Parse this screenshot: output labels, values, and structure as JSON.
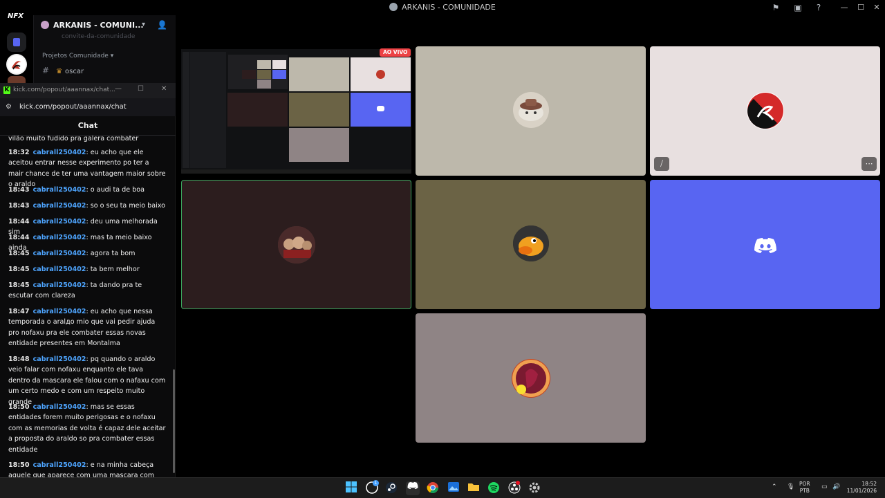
{
  "window": {
    "title": "ARKANIS - COMUNIDADE"
  },
  "rail": {
    "logo": "NFX"
  },
  "channels": {
    "guild_name": "ARKANIS - COMUNI...",
    "faded_item": "convite-da-comunidade",
    "category": "Projetos Comunidade",
    "channel_name": "oscar"
  },
  "popup": {
    "title": "kick.com/popout/aaannax/chat...",
    "url": "kick.com/popout/aaannax/chat",
    "chat_header": "Chat",
    "messages": [
      {
        "time": "",
        "user": "",
        "text": "vilão muito fudido pra galera combater"
      },
      {
        "time": "18:32",
        "user": "cabrall250402",
        "text": ": eu acho que ele aceitou entrar nesse experimento po ter a mair chance de ter uma vantagem maior sobre o araldo"
      },
      {
        "time": "18:43",
        "user": "cabrall250402",
        "text": ": o audi ta de boa"
      },
      {
        "time": "18:43",
        "user": "cabrall250402",
        "text": ": so o seu ta meio baixo"
      },
      {
        "time": "18:44",
        "user": "cabrall250402",
        "text": ": deu uma melhorada sim"
      },
      {
        "time": "18:44",
        "user": "cabrall250402",
        "text": ": mas ta meio baixo ainda"
      },
      {
        "time": "18:45",
        "user": "cabrall250402",
        "text": ": agora ta bom"
      },
      {
        "time": "18:45",
        "user": "cabrall250402",
        "text": ": ta bem melhor"
      },
      {
        "time": "18:45",
        "user": "cabrall250402",
        "text": ": ta dando pra te escutar com clareza"
      },
      {
        "time": "18:47",
        "user": "cabrall250402",
        "text": ": eu acho que nessa temporada o aralдo mio que vai pedir ajuda pro nofaxu pra ele combater essas novas entidade presentes em Montalma"
      },
      {
        "time": "18:48",
        "user": "cabrall250402",
        "text": ": pq quando o araldo veio falar com nofaxu enquanto ele tava dentro da mascara ele falou com o nafaxu com um certo medo e com um respeito muito grande"
      },
      {
        "time": "18:50",
        "user": "cabrall250402",
        "text": ": mas se essas entidades forem muito perigosas e o nofaxu com as memorias de volta é capaz dele aceitar a proposta do araldo so pra combater essas entidade"
      },
      {
        "time": "18:50",
        "user": "cabrall250402",
        "text": ": e na minha cabeça aquele que aparece com uma mascara com rubranya é uma versão do araldo muito mais poderosa"
      }
    ]
  },
  "stage": {
    "live_badge": "AO VIVO"
  },
  "taskbar": {
    "whatsapp_badge": "1",
    "lang_line1": "POR",
    "lang_line2": "PTB",
    "time": "18:52",
    "date": "11/01/2026"
  },
  "colors": {
    "discord_blurple": "#5865f2",
    "speaking_green": "#3ba55d",
    "kick_green": "#53fc18",
    "username_blue": "#4ea5ff",
    "live_red": "#ed4245"
  }
}
